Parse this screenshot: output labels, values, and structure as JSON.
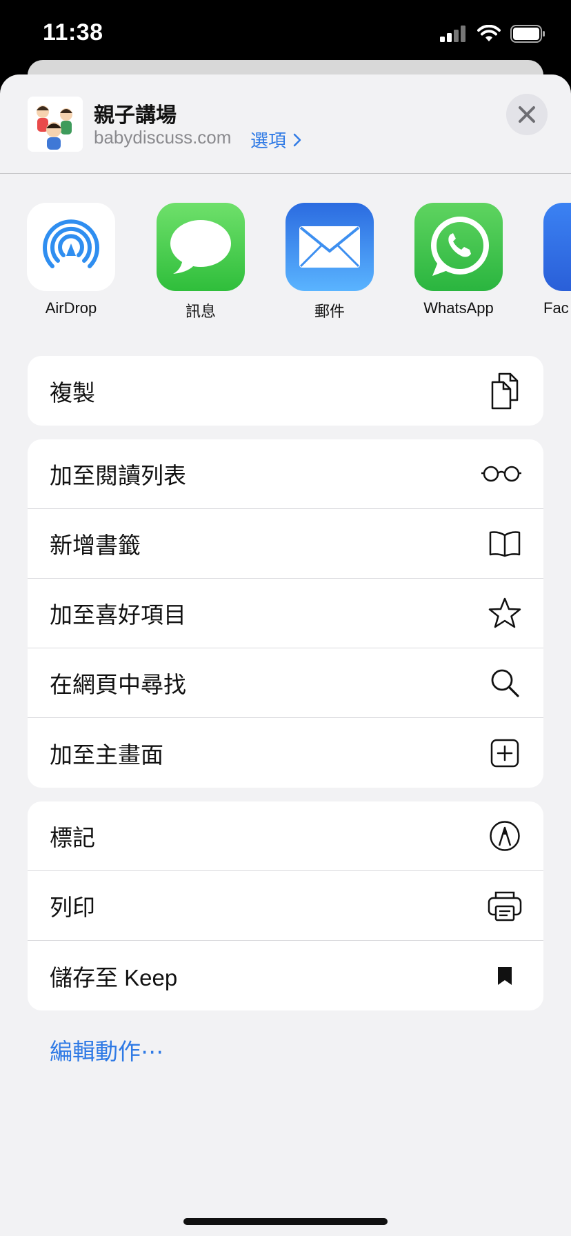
{
  "status": {
    "time": "11:38"
  },
  "header": {
    "site_title": "親子講場",
    "site_url": "babydiscuss.com",
    "options_label": "選項"
  },
  "apps": [
    {
      "label": "AirDrop",
      "icon": "airdrop-icon"
    },
    {
      "label": "訊息",
      "icon": "messages-icon"
    },
    {
      "label": "郵件",
      "icon": "mail-icon"
    },
    {
      "label": "WhatsApp",
      "icon": "whatsapp-icon"
    },
    {
      "label": "Fac",
      "icon": "facebook-icon"
    }
  ],
  "groups": [
    [
      {
        "label": "複製",
        "icon": "copy-icon"
      }
    ],
    [
      {
        "label": "加至閱讀列表",
        "icon": "glasses-icon"
      },
      {
        "label": "新增書籤",
        "icon": "book-icon"
      },
      {
        "label": "加至喜好項目",
        "icon": "star-icon"
      },
      {
        "label": "在網頁中尋找",
        "icon": "search-icon"
      },
      {
        "label": "加至主畫面",
        "icon": "add-square-icon"
      }
    ],
    [
      {
        "label": "標記",
        "icon": "markup-icon"
      },
      {
        "label": "列印",
        "icon": "printer-icon"
      },
      {
        "label": "儲存至 Keep",
        "icon": "bookmark-icon"
      }
    ]
  ],
  "edit_actions": "編輯動作⋯",
  "colors": {
    "accent": "#2f7ae5",
    "sheet_bg": "#f2f2f4"
  }
}
